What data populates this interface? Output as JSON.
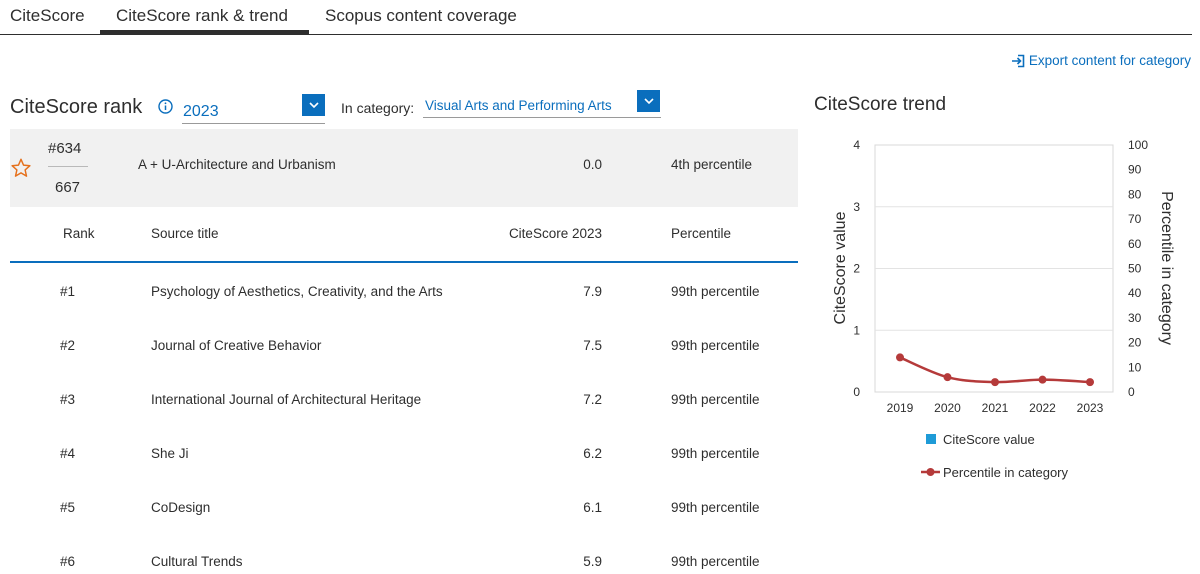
{
  "tabs": [
    {
      "label": "CiteScore"
    },
    {
      "label": "CiteScore rank & trend"
    },
    {
      "label": "Scopus content coverage"
    }
  ],
  "export_label": "Export content for category",
  "rank": {
    "title": "CiteScore rank",
    "year": "2023",
    "category_label": "In category:",
    "category": "Visual Arts and Performing Arts"
  },
  "highlight": {
    "rank": "#634",
    "total": "667",
    "title": "A + U-Architecture and Urbanism",
    "score": "0.0",
    "percentile": "4th percentile"
  },
  "table": {
    "headers": {
      "rank": "Rank",
      "title": "Source title",
      "score": "CiteScore 2023",
      "percentile": "Percentile"
    },
    "rows": [
      {
        "rank": "#1",
        "title": "Psychology of Aesthetics, Creativity, and the Arts",
        "score": "7.9",
        "percentile": "99th percentile"
      },
      {
        "rank": "#2",
        "title": "Journal of Creative Behavior",
        "score": "7.5",
        "percentile": "99th percentile"
      },
      {
        "rank": "#3",
        "title": "International Journal of Architectural Heritage",
        "score": "7.2",
        "percentile": "99th percentile"
      },
      {
        "rank": "#4",
        "title": "She Ji",
        "score": "6.2",
        "percentile": "99th percentile"
      },
      {
        "rank": "#5",
        "title": "CoDesign",
        "score": "6.1",
        "percentile": "99th percentile"
      },
      {
        "rank": "#6",
        "title": "Cultural Trends",
        "score": "5.9",
        "percentile": "99th percentile"
      }
    ]
  },
  "trend": {
    "title": "CiteScore trend"
  },
  "colors": {
    "accent": "#0a6ebd",
    "percentile_line": "#b53a3a",
    "citescore_legend": "#1e9bd7",
    "star": "#e5711d"
  },
  "chart_data": {
    "type": "line",
    "x": [
      "2019",
      "2020",
      "2021",
      "2022",
      "2023"
    ],
    "series": [
      {
        "name": "CiteScore value",
        "axis": "left",
        "values": [
          null,
          null,
          null,
          null,
          null
        ]
      },
      {
        "name": "Percentile in category",
        "axis": "right",
        "values": [
          14,
          6,
          4,
          5,
          4
        ]
      }
    ],
    "ylabel": "CiteScore value",
    "ylim": [
      0,
      4
    ],
    "yticks": [
      "0",
      "1",
      "2",
      "3",
      "4"
    ],
    "y2label": "Percentile in category",
    "y2lim": [
      0,
      100
    ],
    "y2ticks": [
      "0",
      "10",
      "20",
      "30",
      "40",
      "50",
      "60",
      "70",
      "80",
      "90",
      "100"
    ],
    "grid": true,
    "legend": "bottom"
  }
}
